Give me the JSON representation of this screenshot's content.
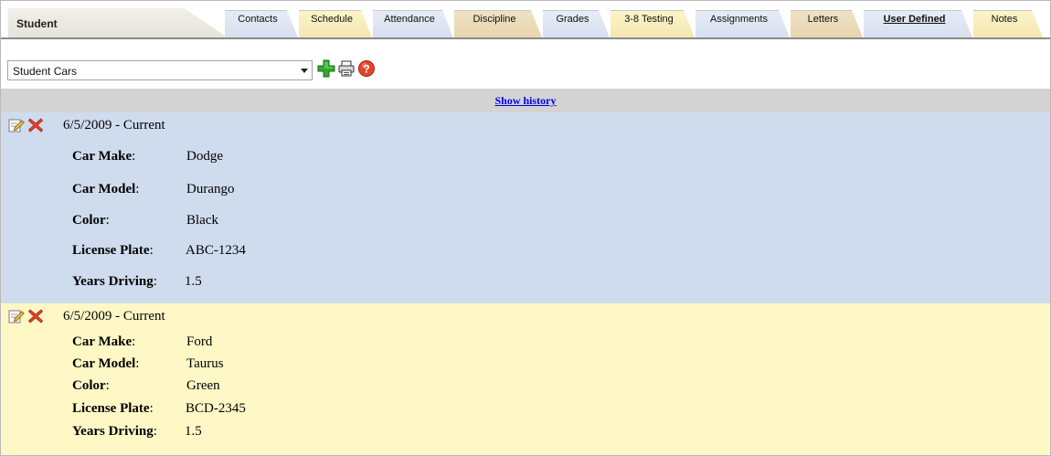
{
  "header": {
    "student_label": "Student",
    "tabs": [
      {
        "label": "Contacts",
        "style": "blue"
      },
      {
        "label": "Schedule",
        "style": "yellow"
      },
      {
        "label": "Attendance",
        "style": "blue"
      },
      {
        "label": "Discipline",
        "style": "tan"
      },
      {
        "label": "Grades",
        "style": "blue"
      },
      {
        "label": "3-8 Testing",
        "style": "yellow"
      },
      {
        "label": "Assignments",
        "style": "blue"
      },
      {
        "label": "Letters",
        "style": "tan"
      },
      {
        "label": "User Defined",
        "style": "blue",
        "active": true
      },
      {
        "label": "Notes",
        "style": "yellow"
      }
    ]
  },
  "toolbar": {
    "selected_form": "Student Cars",
    "icons": [
      "add-icon",
      "print-icon",
      "help-icon"
    ]
  },
  "history": {
    "link_label": "Show history"
  },
  "records": [
    {
      "date_text": "6/5/2009  -  Current",
      "fields": [
        {
          "label": "Car Make",
          "value": "Dodge"
        },
        {
          "label": "Car Model",
          "value": "Durango"
        },
        {
          "label": "Color",
          "value": "Black"
        },
        {
          "label": "License Plate",
          "value": "ABC-1234"
        },
        {
          "label": "Years Driving",
          "value": "1.5"
        }
      ]
    },
    {
      "date_text": "6/5/2009  -  Current",
      "fields": [
        {
          "label": "Car Make",
          "value": "Ford"
        },
        {
          "label": "Car Model",
          "value": "Taurus"
        },
        {
          "label": "Color",
          "value": "Green"
        },
        {
          "label": "License Plate",
          "value": "BCD-2345"
        },
        {
          "label": "Years Driving",
          "value": "1.5"
        }
      ]
    }
  ],
  "colors": {
    "record_blue": "#cfdcee",
    "record_yellow": "#fff8c6",
    "history_bar": "#d3d3d3",
    "link": "#0000ee"
  }
}
